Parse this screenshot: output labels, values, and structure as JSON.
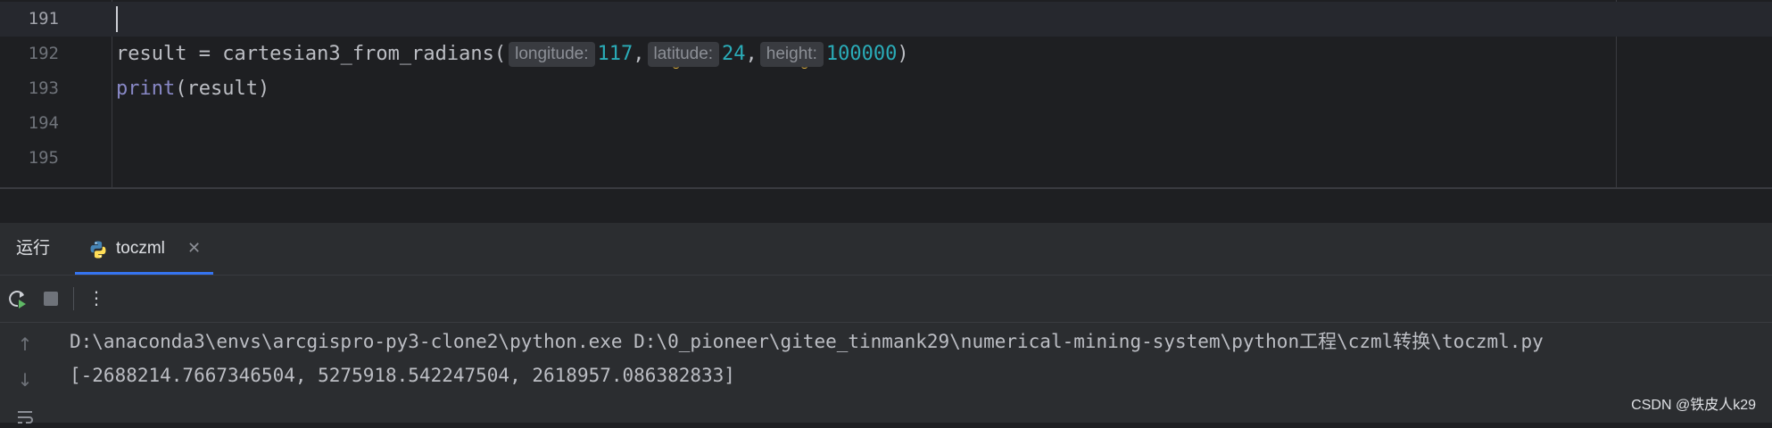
{
  "editor": {
    "lines": [
      {
        "num": "191",
        "text": ""
      },
      {
        "num": "192",
        "prefix": "result = cartesian3_from_radians(",
        "hint1": "longitude:",
        "arg1": "117",
        "sep1": ",",
        "hint2": "latitude:",
        "arg2": "24",
        "sep2": ",",
        "hint3": "height:",
        "arg3": "100000",
        "suffix": ")"
      },
      {
        "num": "193",
        "fn": "print",
        "rest": "(result)"
      },
      {
        "num": "194",
        "text": ""
      },
      {
        "num": "195",
        "text": ""
      }
    ]
  },
  "run_panel": {
    "title": "运行",
    "tab_label": "toczml",
    "tab_close": "✕"
  },
  "toolbar": {
    "more": "⋮"
  },
  "console": {
    "lines": [
      "D:\\anaconda3\\envs\\arcgispro-py3-clone2\\python.exe D:\\0_pioneer\\gitee_tinmank29\\numerical-mining-system\\python工程\\czml转换\\toczml.py",
      "[-2688214.7667346504, 5275918.542247504, 2618957.086382833]"
    ]
  },
  "watermark": "CSDN @铁皮人k29",
  "colors": {
    "background": "#1e1f22",
    "panel": "#2b2d30",
    "number": "#2aacb8",
    "builtin": "#8888c6",
    "accent": "#3574f0"
  }
}
